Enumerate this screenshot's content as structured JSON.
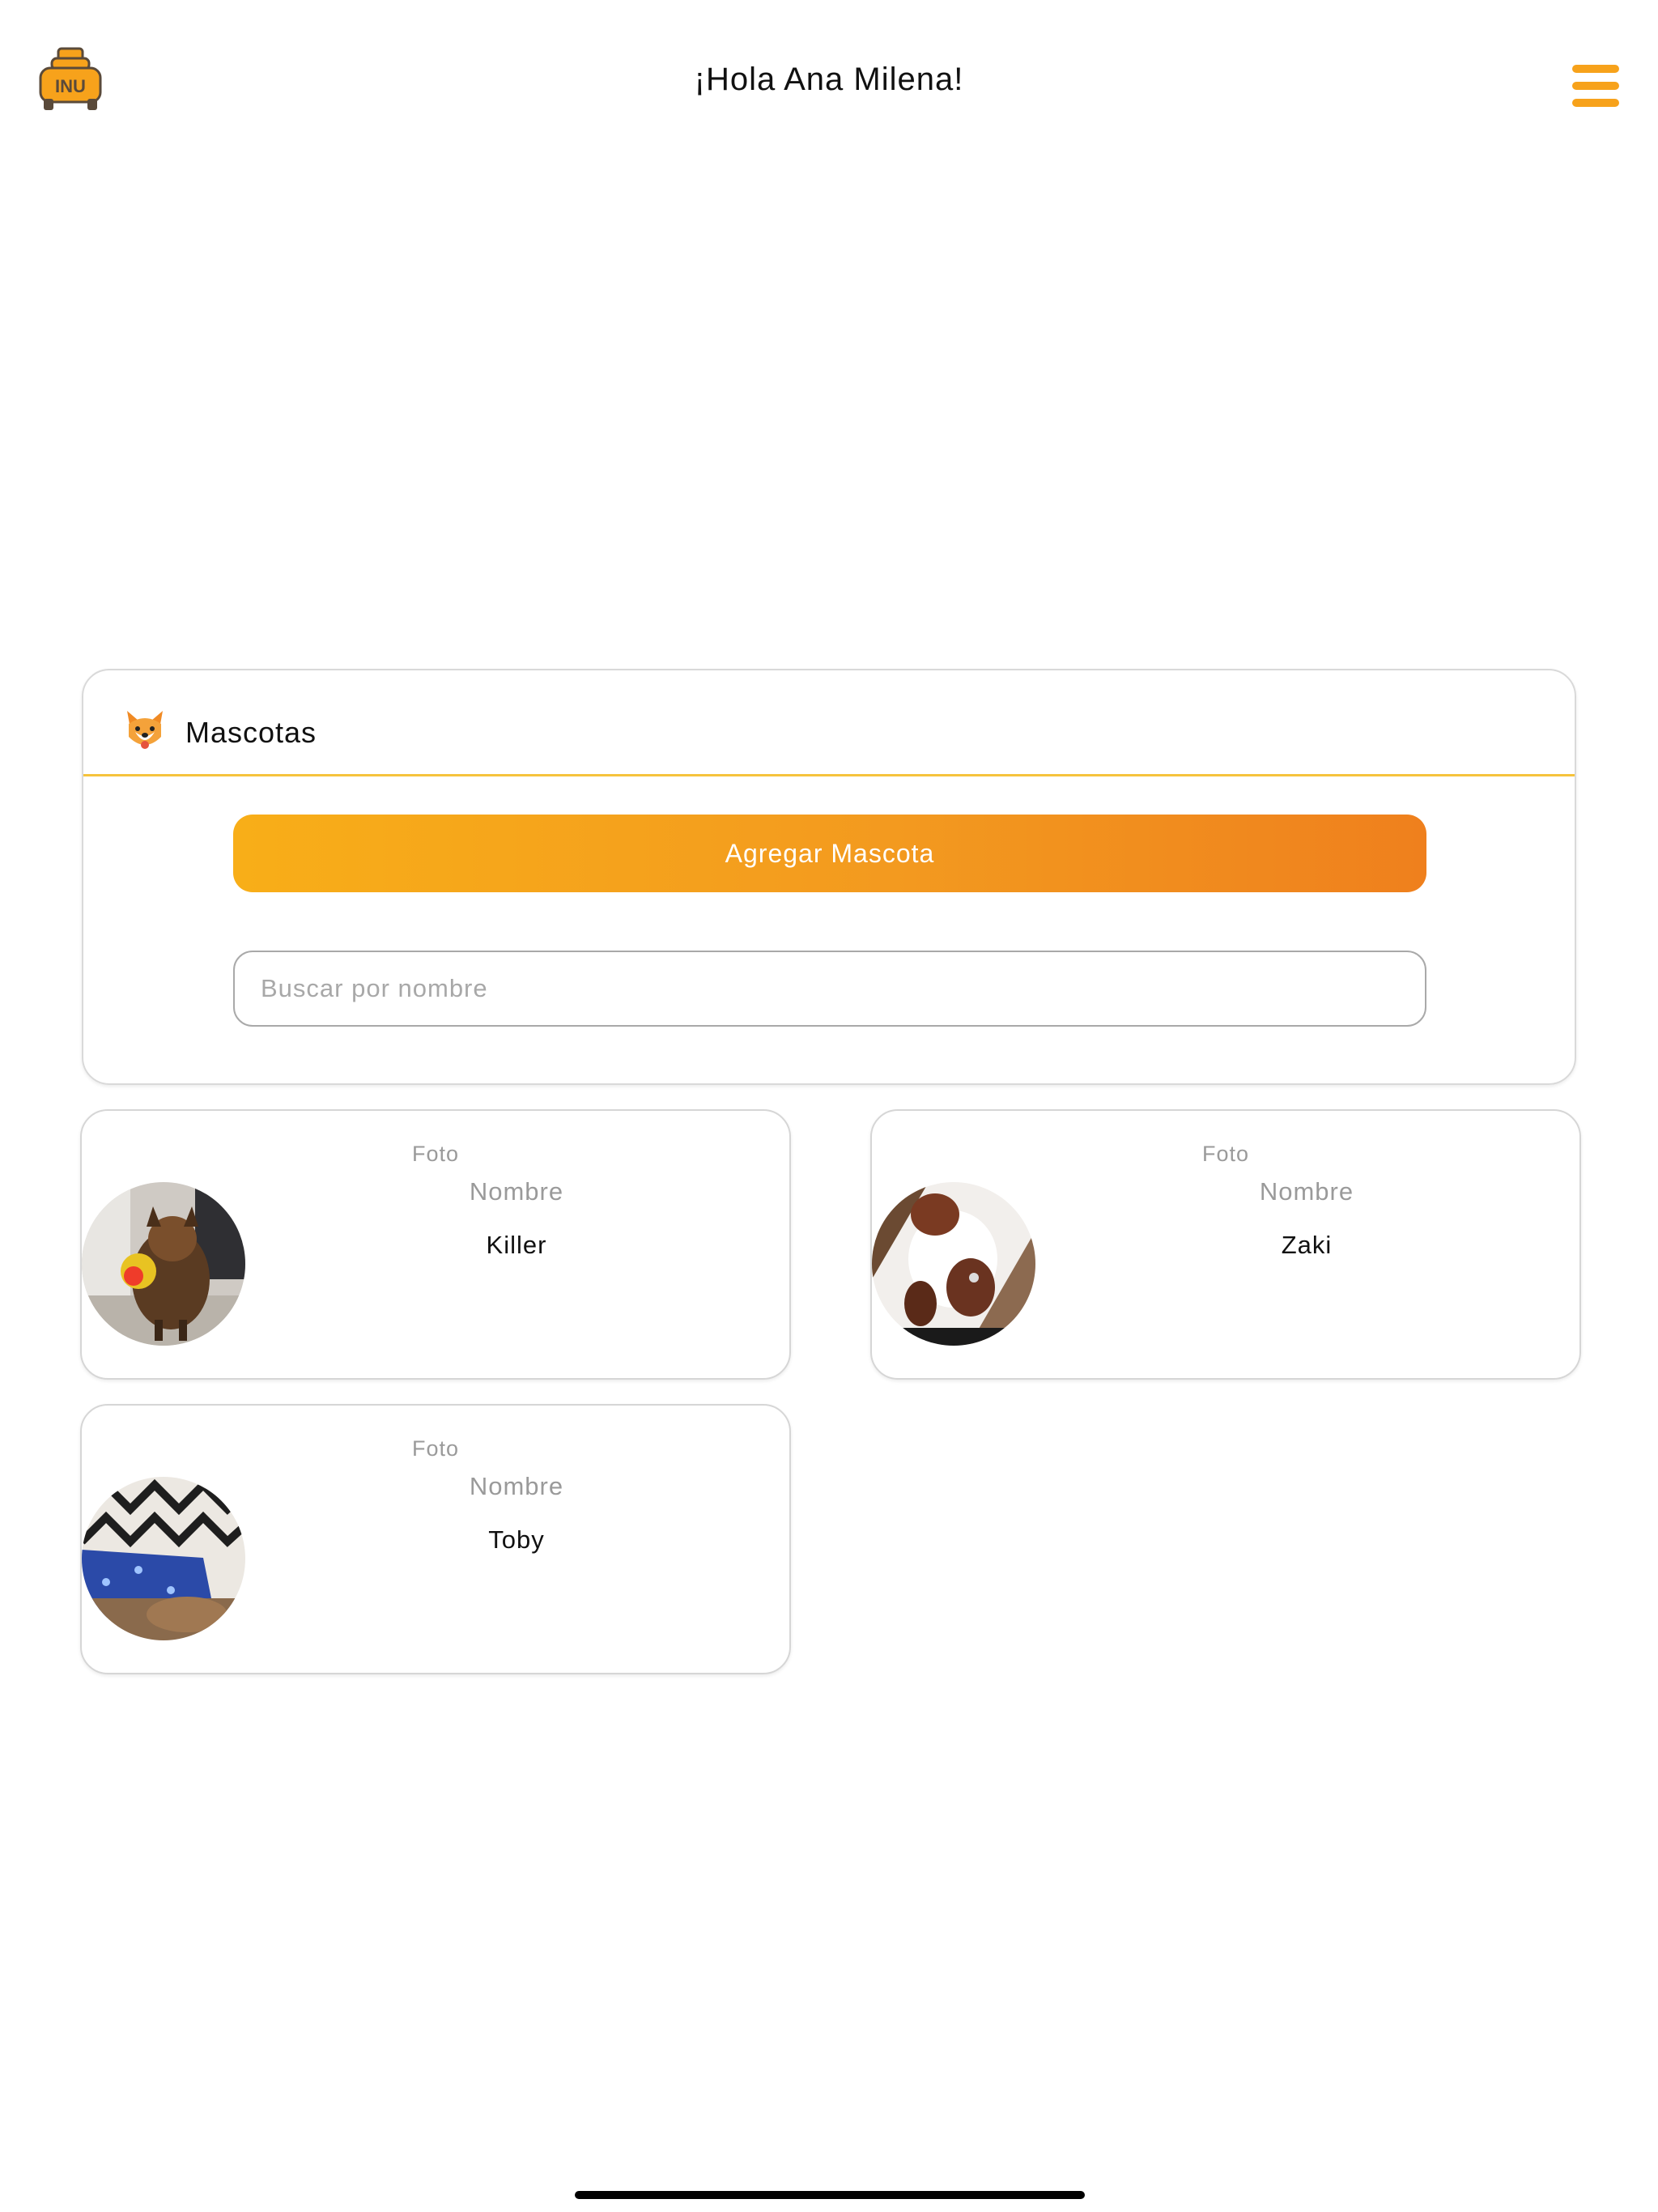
{
  "header": {
    "logo_text": "INU",
    "greeting": "¡Hola Ana Milena!"
  },
  "panel": {
    "title": "Mascotas",
    "add_button": "Agregar Mascota",
    "search_placeholder": "Buscar por nombre",
    "search_value": ""
  },
  "pets": [
    {
      "foto_label": "Foto",
      "nombre_label": "Nombre",
      "name": "Killer"
    },
    {
      "foto_label": "Foto",
      "nombre_label": "Nombre",
      "name": "Zaki"
    },
    {
      "foto_label": "Foto",
      "nombre_label": "Nombre",
      "name": "Toby"
    }
  ],
  "colors": {
    "accent": "#f7a21b",
    "button_start": "#f8ae18",
    "button_end": "#ef801d",
    "divider": "#f6c33c"
  }
}
